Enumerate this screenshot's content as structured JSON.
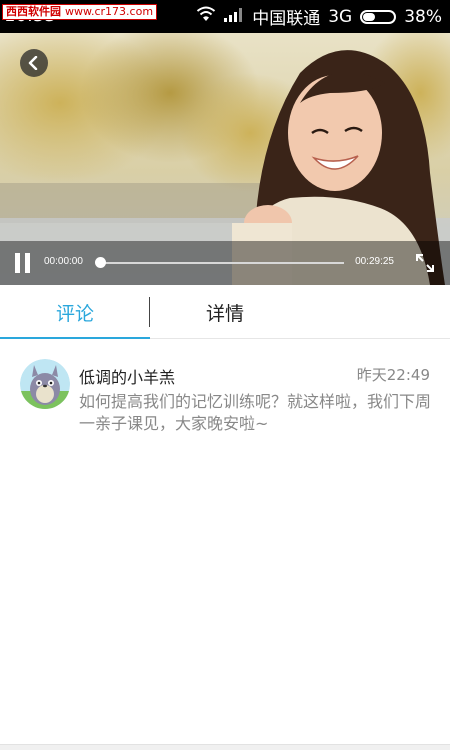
{
  "status_bar": {
    "time": "10:53",
    "watermark_site": "西西软件园",
    "watermark_url": "www.cr173.com",
    "carrier": "中国联通",
    "network": "3G",
    "battery_text": "38%",
    "battery_level": 0.38,
    "icons": [
      "wifi-icon",
      "signal-icon",
      "battery-icon"
    ]
  },
  "video": {
    "current_time": "00:00:00",
    "total_time": "00:29:25",
    "progress": 0,
    "icons": [
      "back-arrow-icon",
      "pause-icon",
      "fullscreen-icon"
    ]
  },
  "tabs": [
    {
      "label": "评论",
      "active": true
    },
    {
      "label": "详情",
      "active": false
    }
  ],
  "comments": [
    {
      "user": "低调的小羊羔",
      "time": "昨天22:49",
      "text": "如何提高我们的记忆训练呢？就这样啦，我们下周一亲子课见，大家晚安啦~"
    }
  ],
  "colors": {
    "accent": "#2aa7dc",
    "status_bar": "#000000",
    "muted_text": "#888888"
  }
}
